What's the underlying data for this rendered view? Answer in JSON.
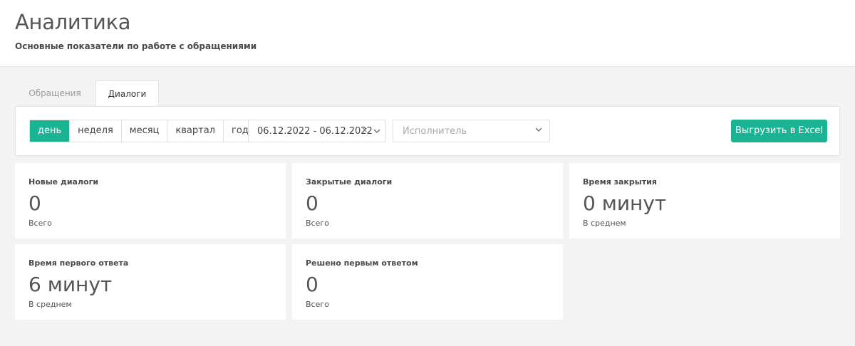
{
  "header": {
    "title": "Аналитика",
    "subtitle": "Основные показатели по работе с обращениями"
  },
  "tabs": [
    {
      "label": "Обращения",
      "active": false
    },
    {
      "label": "Диалоги",
      "active": true
    }
  ],
  "filters": {
    "periods": [
      {
        "label": "день",
        "active": true
      },
      {
        "label": "неделя",
        "active": false
      },
      {
        "label": "месяц",
        "active": false
      },
      {
        "label": "квартал",
        "active": false
      },
      {
        "label": "год",
        "active": false
      }
    ],
    "date_range": "06.12.2022 - 06.12.2022",
    "clear_symbol": "×",
    "assignee_placeholder": "Исполнитель",
    "export_label": "Выгрузить в Excel"
  },
  "cards": [
    {
      "title": "Новые диалоги",
      "value": "0",
      "caption": "Всего"
    },
    {
      "title": "Закрытые диалоги",
      "value": "0",
      "caption": "Всего"
    },
    {
      "title": "Время закрытия",
      "value": "0 минут",
      "caption": "В среднем"
    },
    {
      "title": "Время первого ответа",
      "value": "6 минут",
      "caption": "В среднем"
    },
    {
      "title": "Решено первым ответом",
      "value": "0",
      "caption": "Всего"
    }
  ],
  "colors": {
    "accent": "#1ab394",
    "background": "#f3f3f3"
  }
}
